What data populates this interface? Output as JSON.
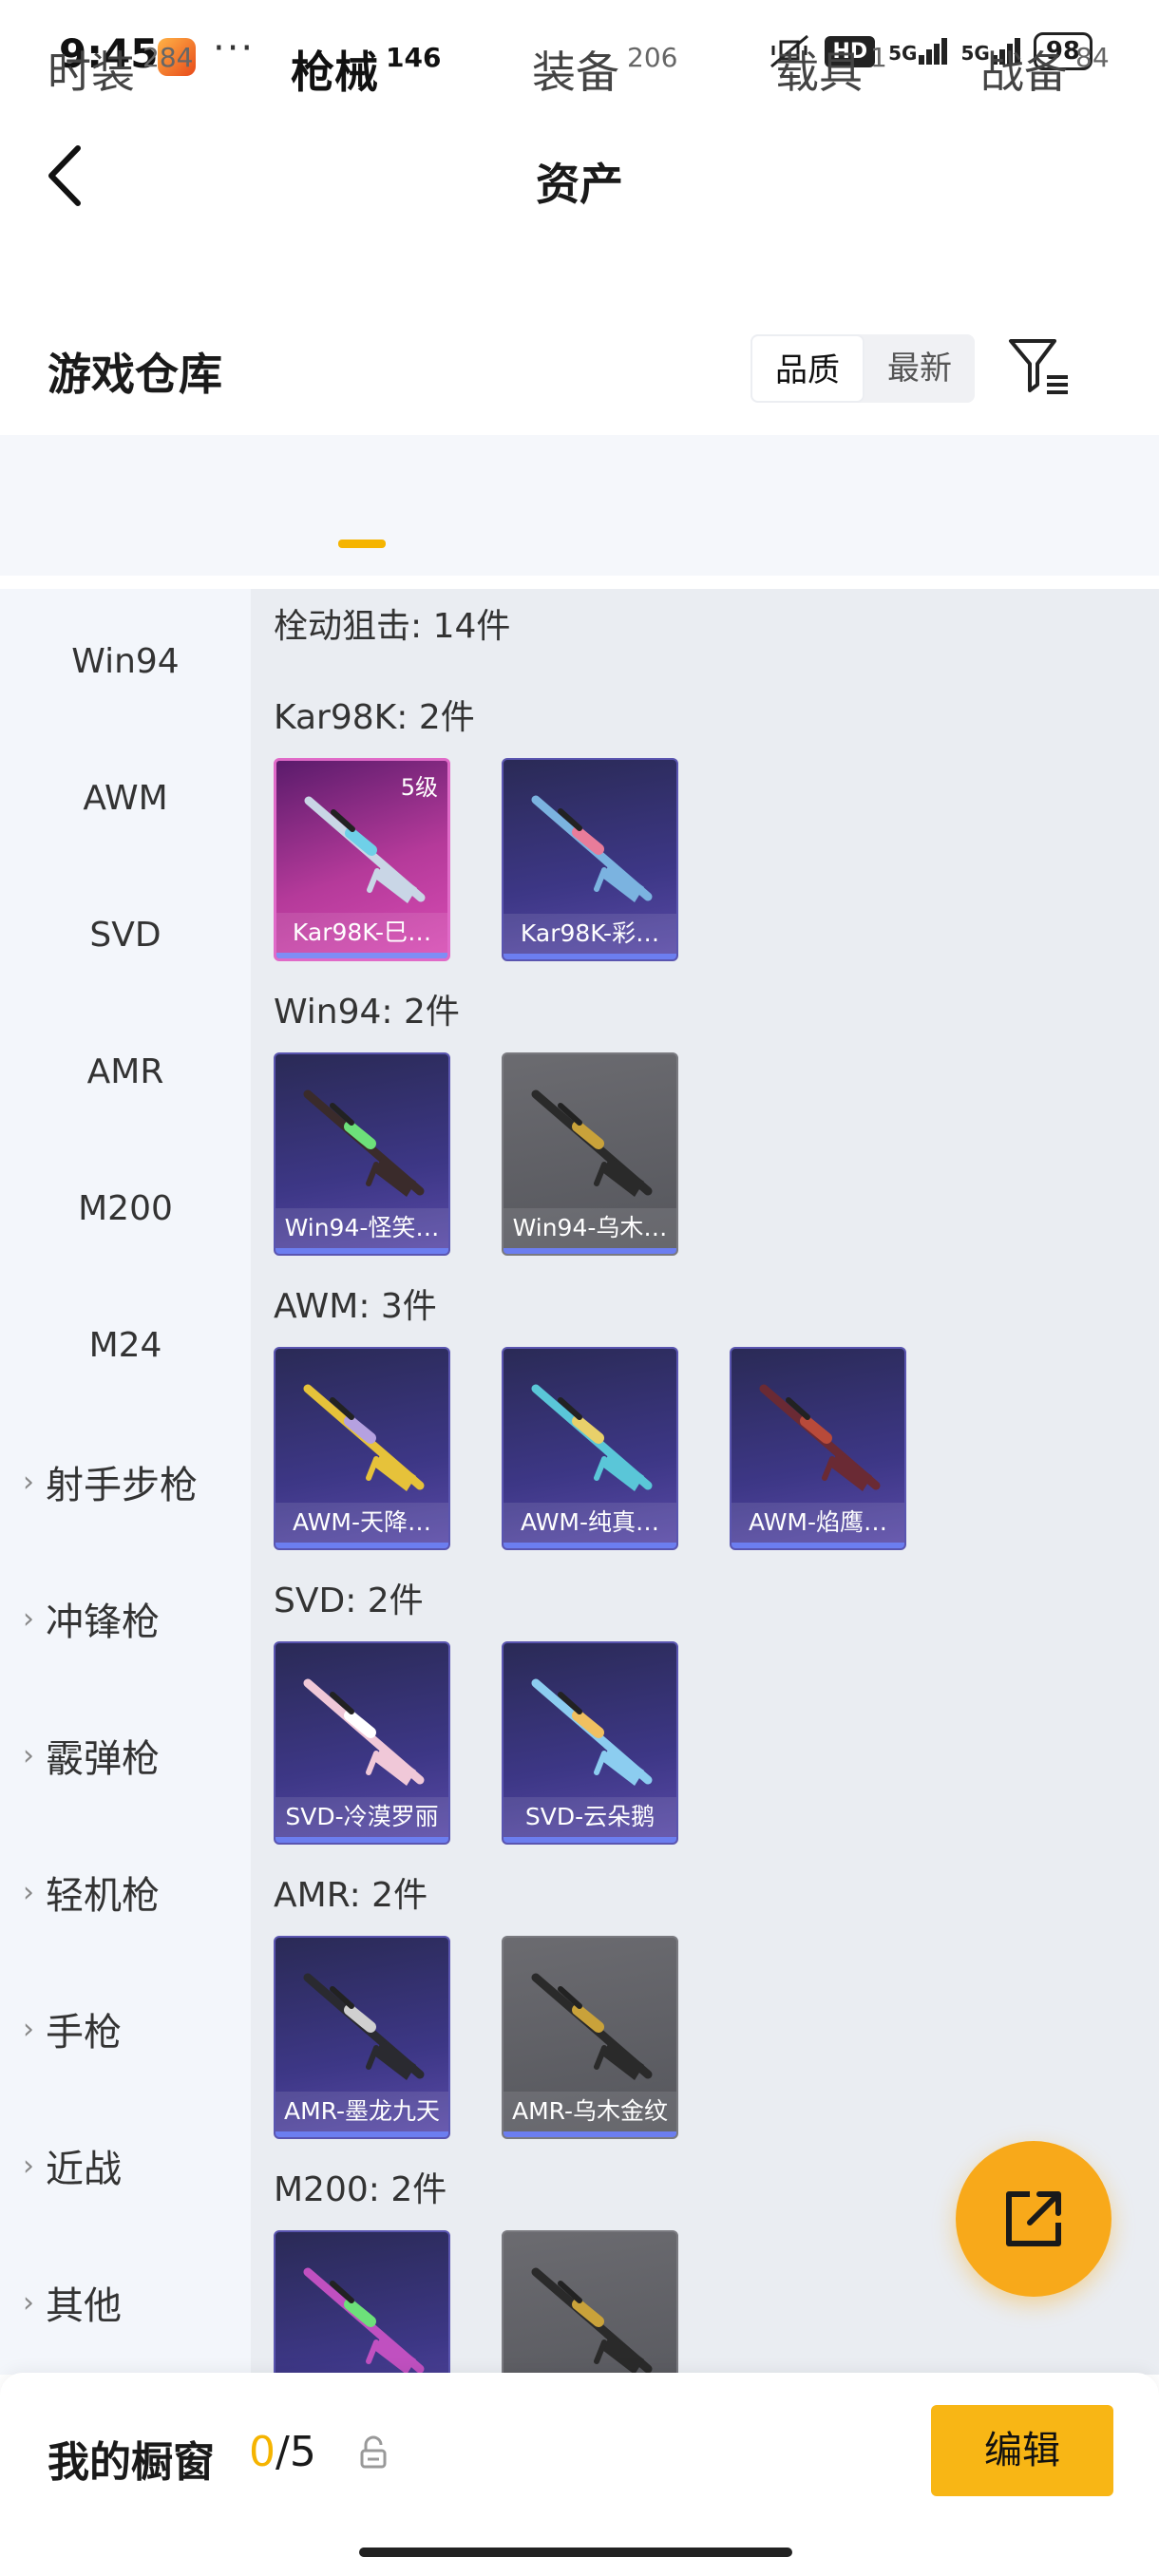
{
  "status_bar": {
    "time": "9:45",
    "app_icon": "game-app-icon",
    "more": "···",
    "hd": "HD",
    "network_1": "5G",
    "network_2": "5G",
    "battery": "98"
  },
  "header": {
    "title": "资产"
  },
  "warehouse": {
    "title": "游戏仓库",
    "sort": {
      "quality": "品质",
      "newest": "最新",
      "selected": "品质"
    }
  },
  "tabs": [
    {
      "label": "时装",
      "count": "284"
    },
    {
      "label": "枪械",
      "count": "146",
      "active": true
    },
    {
      "label": "装备",
      "count": "206"
    },
    {
      "label": "载具",
      "count": "1"
    },
    {
      "label": "战备",
      "count": "84"
    }
  ],
  "sidebar": {
    "weapons": [
      "Win94",
      "AWM",
      "SVD",
      "AMR",
      "M200",
      "M24"
    ],
    "categories": [
      "射手步枪",
      "冲锋枪",
      "霰弹枪",
      "轻机枪",
      "手枪",
      "近战",
      "其他"
    ]
  },
  "content": {
    "group_title": "栓动狙击: 14件",
    "sections": [
      {
        "title": "Kar98K: 2件",
        "items": [
          {
            "label": "Kar98K-巳…",
            "level": "5级",
            "style": "pink",
            "gun_color": "#c9d6e6",
            "accent": "#6fd0e8"
          },
          {
            "label": "Kar98K-彩…",
            "style": "purple",
            "gun_color": "#7bb3e0",
            "accent": "#e87c9a"
          }
        ]
      },
      {
        "title": "Win94: 2件",
        "items": [
          {
            "label": "Win94-怪笑…",
            "style": "purple",
            "gun_color": "#3a2b2b",
            "accent": "#6de07a"
          },
          {
            "label": "Win94-乌木…",
            "style": "gray",
            "gun_color": "#2a2a2a",
            "accent": "#c9a23a"
          }
        ]
      },
      {
        "title": "AWM: 3件",
        "items": [
          {
            "label": "AWM-天降…",
            "style": "purple",
            "gun_color": "#e6c23a",
            "accent": "#b5a1e0"
          },
          {
            "label": "AWM-纯真…",
            "style": "purple",
            "gun_color": "#5ac6d8",
            "accent": "#e8d06a"
          },
          {
            "label": "AWM-焰鹰…",
            "style": "purple",
            "gun_color": "#6a2a34",
            "accent": "#b84a3a"
          }
        ]
      },
      {
        "title": "SVD: 2件",
        "items": [
          {
            "label": "SVD-冷漠罗丽",
            "style": "purple",
            "gun_color": "#f0c8d8",
            "accent": "#ffffff"
          },
          {
            "label": "SVD-云朵鹅",
            "style": "purple",
            "gun_color": "#8ccdf0",
            "accent": "#f0c060"
          }
        ]
      },
      {
        "title": "AMR: 2件",
        "items": [
          {
            "label": "AMR-墨龙九天",
            "style": "purple",
            "gun_color": "#2a2a30",
            "accent": "#d0d0d0"
          },
          {
            "label": "AMR-乌木金纹",
            "style": "gray",
            "gun_color": "#2a2a2a",
            "accent": "#c9a23a"
          }
        ]
      },
      {
        "title": "M200: 2件",
        "items": [
          {
            "label": "",
            "style": "purple",
            "gun_color": "#c050c0",
            "accent": "#6de07a"
          },
          {
            "label": "",
            "style": "gray",
            "gun_color": "#2a2a2a",
            "accent": "#c9a23a"
          }
        ]
      }
    ]
  },
  "fab": {
    "icon": "share-external-icon"
  },
  "bottom": {
    "showcase_label": "我的橱窗",
    "current": "0",
    "slash_total": "/5",
    "edit": "编辑"
  },
  "colors": {
    "accent": "#f5b400",
    "fab": "#f8a91a",
    "edit": "#f8b615"
  }
}
